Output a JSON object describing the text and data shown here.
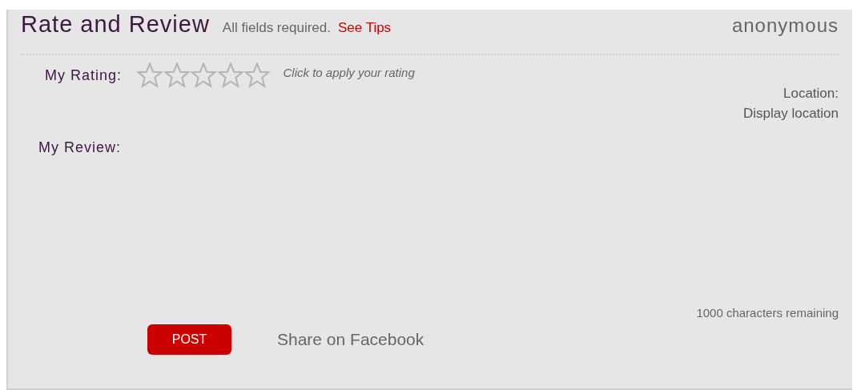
{
  "header": {
    "title": "Rate and Review",
    "note": "All fields required.",
    "tips_link": "See Tips",
    "user": "anonymous"
  },
  "rating": {
    "label": "My Rating:",
    "stars": 0,
    "hint": "Click to apply your rating"
  },
  "location": {
    "label": "Location:",
    "value": "Display location"
  },
  "review": {
    "label": "My Review:",
    "counter": "1000 characters remaining"
  },
  "actions": {
    "post": "POST",
    "share": "Share on Facebook"
  }
}
